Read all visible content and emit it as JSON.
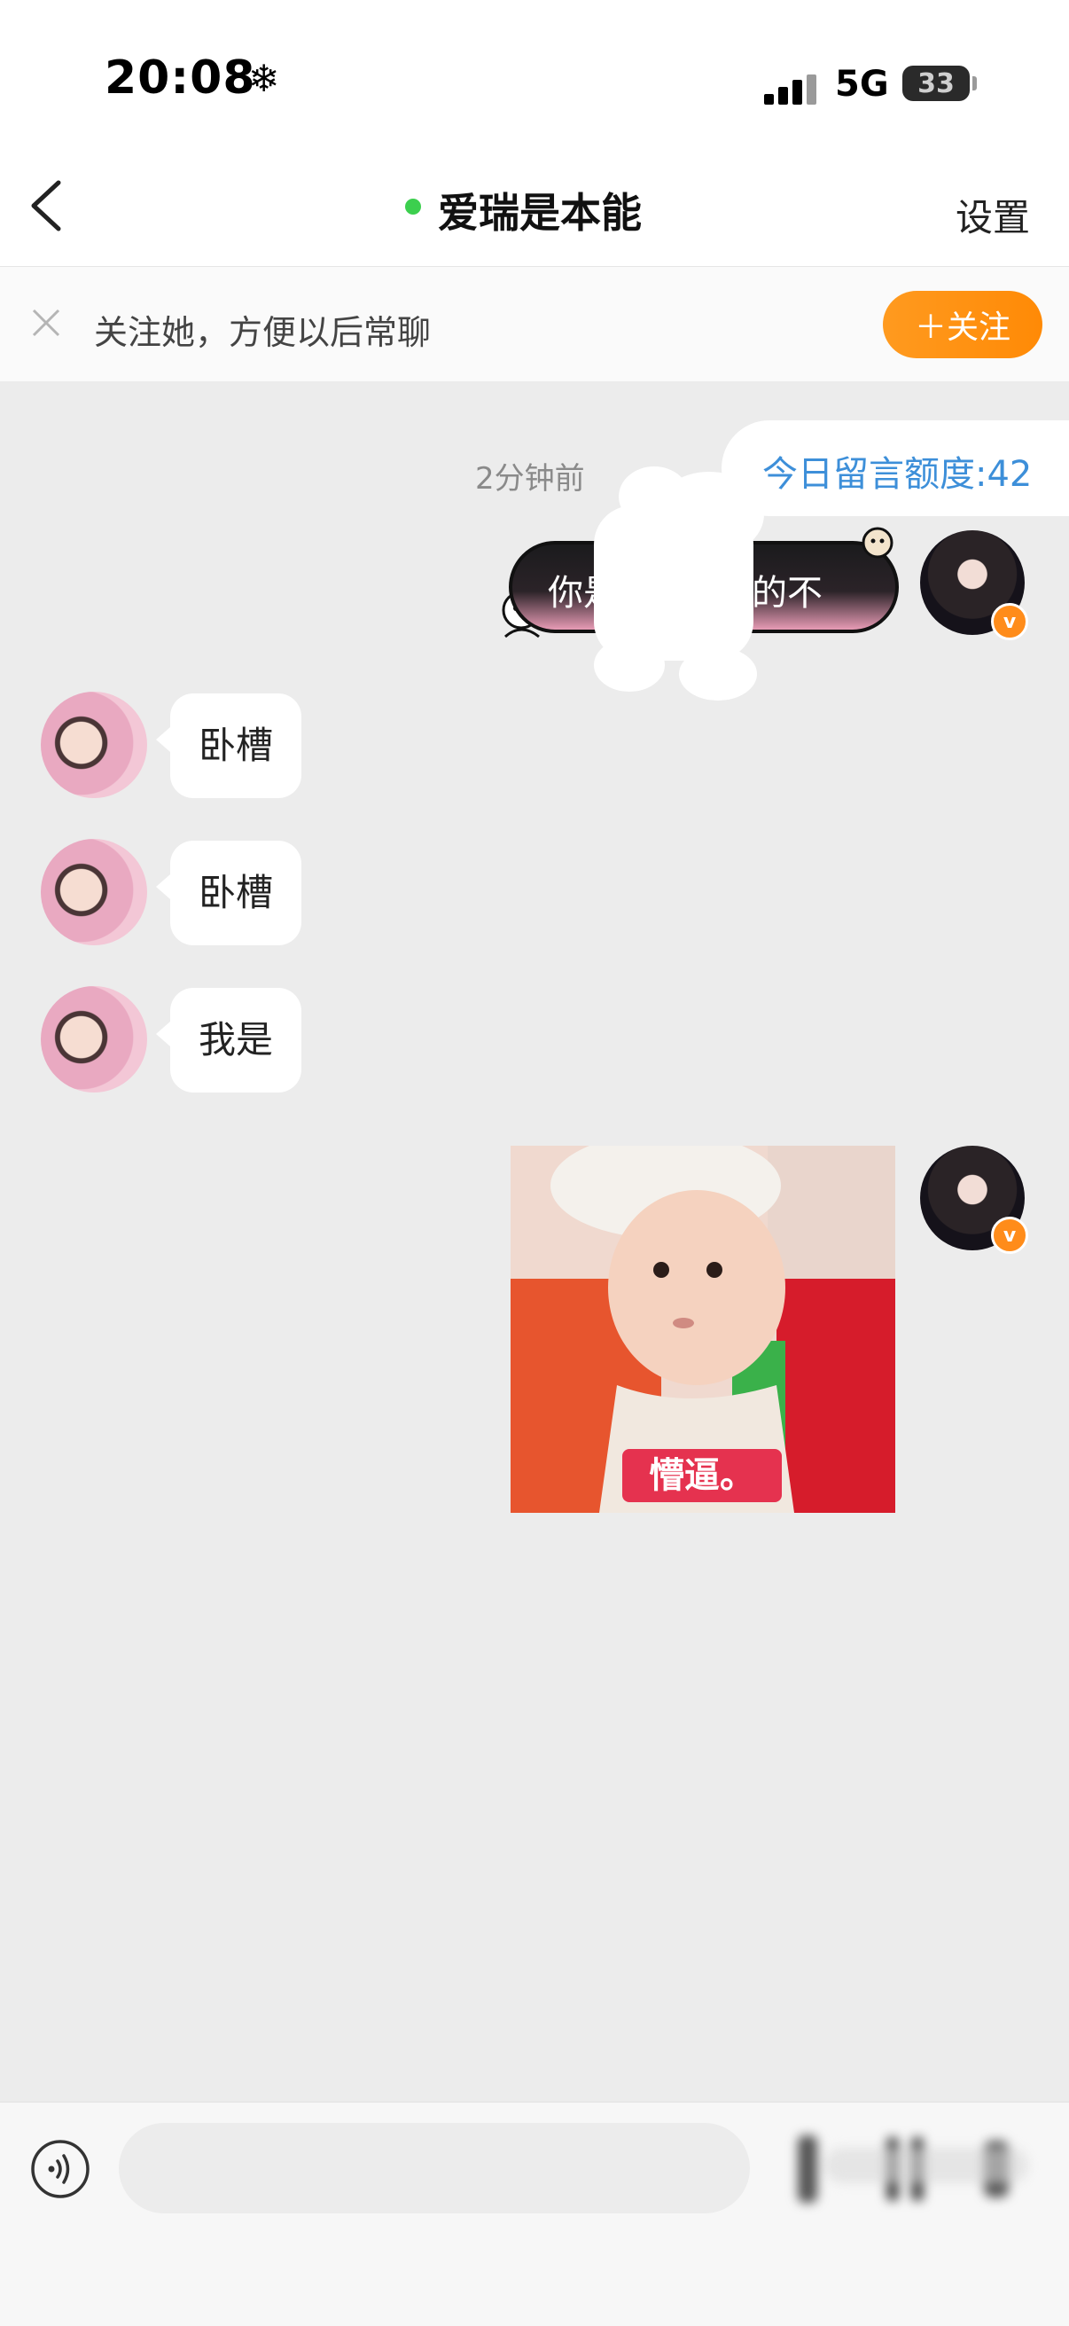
{
  "status_bar": {
    "time": "20:08",
    "weather_glyph": "❄",
    "network": "5G",
    "battery": "33"
  },
  "header": {
    "title": "爱瑞是本能",
    "settings_label": "设置",
    "online": true
  },
  "banner": {
    "text": "关注她，方便以后常聊",
    "follow_label": "＋关注"
  },
  "chat": {
    "timestamp": "2分钟前",
    "quota": "今日留言额度:42",
    "messages": [
      {
        "side": "right",
        "type": "sticker",
        "text": "你是",
        "text_tail": "的不"
      },
      {
        "side": "left",
        "type": "text",
        "text": "卧槽"
      },
      {
        "side": "left",
        "type": "text",
        "text": "卧槽"
      },
      {
        "side": "left",
        "type": "text",
        "text": "我是"
      },
      {
        "side": "right",
        "type": "image",
        "caption": "懵逼。"
      }
    ]
  },
  "input": {
    "placeholder": ""
  },
  "colors": {
    "accent_orange": "#ff8c1a",
    "quota_blue": "#3d8fd9",
    "online_green": "#3ccf4e",
    "caption_red": "#e5324f"
  },
  "icons": {
    "back": "chevron-left-icon",
    "close": "close-icon",
    "voice": "voice-icon",
    "verified": "verified-badge-icon"
  }
}
